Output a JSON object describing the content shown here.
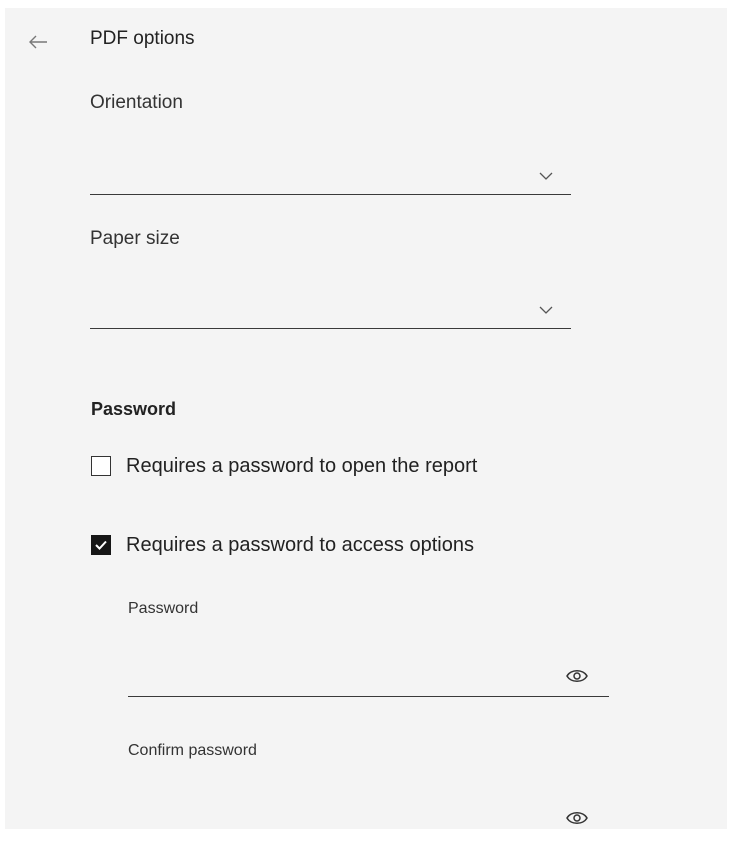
{
  "header": {
    "back_icon": "arrow-left-icon",
    "title": "PDF options"
  },
  "orientation": {
    "label": "Orientation",
    "value": "",
    "icon": "chevron-down-icon"
  },
  "paper_size": {
    "label": "Paper size",
    "value": "",
    "icon": "chevron-down-icon"
  },
  "password_section": {
    "heading": "Password",
    "require_open": {
      "label": "Requires a password to open the report",
      "checked": false
    },
    "require_options": {
      "label": "Requires a password to access options",
      "checked": true
    },
    "password": {
      "label": "Password",
      "value": "",
      "icon": "eye-icon"
    },
    "confirm_password": {
      "label": "Confirm password",
      "value": "",
      "icon": "eye-icon"
    }
  }
}
